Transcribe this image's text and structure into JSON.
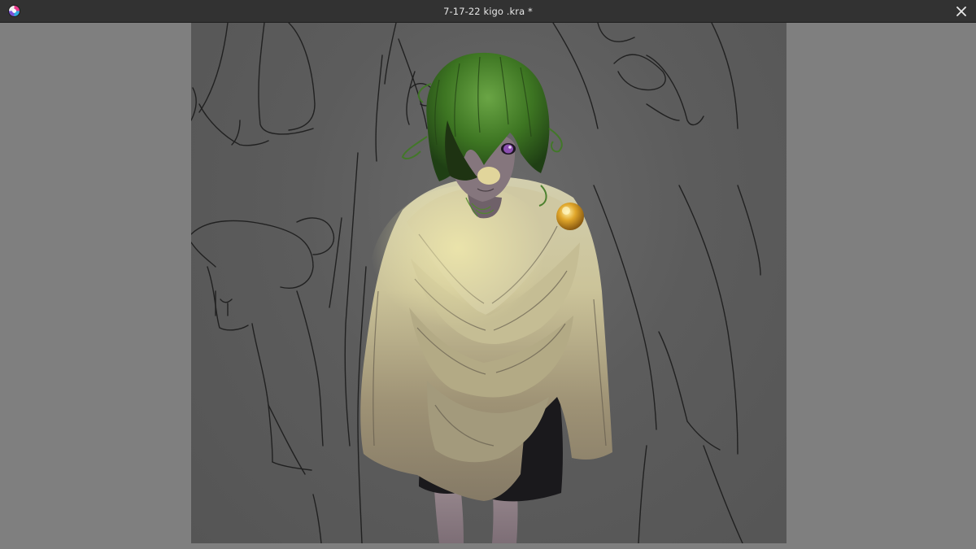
{
  "window": {
    "title": "7-17-22 kigo .kra *",
    "app_icon": "krita-logo-icon",
    "close_icon": "close-icon"
  },
  "canvas": {
    "description_type": "digital painting in progress",
    "colors": {
      "workspace_bg": "#7f7f7f",
      "titlebar_bg": "#323232",
      "hair": "#3f7a23",
      "cloak": "#bdb58e",
      "brooch": "#d19a1f",
      "shorts": "#1b1a1d",
      "skin": "#8b7c84",
      "eye": "#8b4fb0"
    }
  }
}
